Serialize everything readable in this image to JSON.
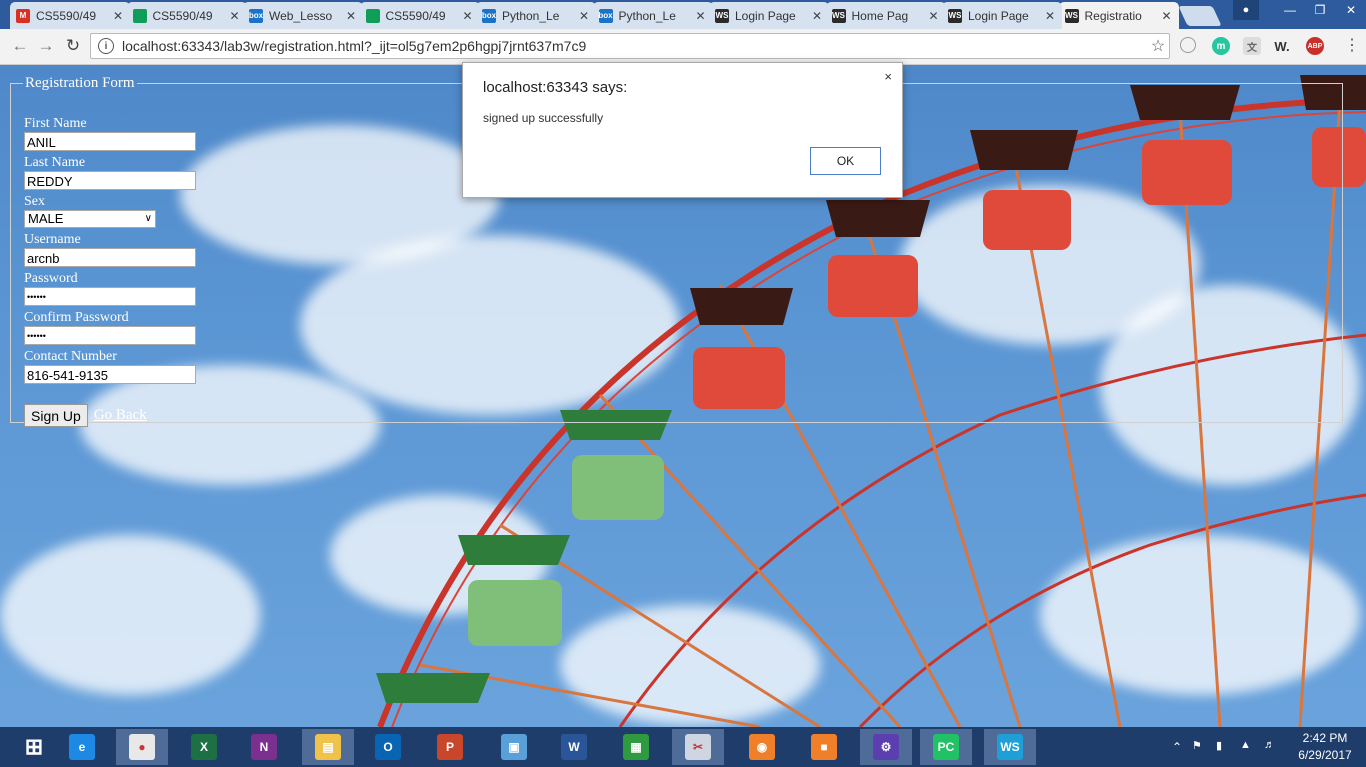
{
  "browser": {
    "tabs": [
      {
        "title": "CS5590/49",
        "icon": "gmail-icon",
        "color": "#d93025",
        "glyph": "M",
        "active": false
      },
      {
        "title": "CS5590/49",
        "icon": "sheets-icon",
        "color": "#0f9d58",
        "glyph": "",
        "active": false
      },
      {
        "title": "Web_Lesso",
        "icon": "box-icon",
        "color": "#1a73c8",
        "glyph": "box",
        "active": false
      },
      {
        "title": "CS5590/49",
        "icon": "sheets-icon",
        "color": "#0f9d58",
        "glyph": "",
        "active": false
      },
      {
        "title": "Python_Le",
        "icon": "box-icon",
        "color": "#1a73c8",
        "glyph": "box",
        "active": false
      },
      {
        "title": "Python_Le",
        "icon": "box-icon",
        "color": "#1a73c8",
        "glyph": "box",
        "active": false
      },
      {
        "title": "Login Page",
        "icon": "webstorm-icon",
        "color": "#2b2b2b",
        "glyph": "WS",
        "active": false
      },
      {
        "title": "Home Pag",
        "icon": "webstorm-icon",
        "color": "#2b2b2b",
        "glyph": "WS",
        "active": false
      },
      {
        "title": "Login Page",
        "icon": "webstorm-icon",
        "color": "#2b2b2b",
        "glyph": "WS",
        "active": false
      },
      {
        "title": "Registratio",
        "icon": "webstorm-icon",
        "color": "#2b2b2b",
        "glyph": "WS",
        "active": true
      }
    ],
    "url": "localhost:63343/lab3w/registration.html?_ijt=ol5g7em2p6hgpj7jrnt637m7c9",
    "extensions": [
      "m",
      "ABP"
    ]
  },
  "form": {
    "legend": "Registration Form",
    "fields": [
      {
        "label": "First Name",
        "value": "ANIL"
      },
      {
        "label": "Last Name",
        "value": "REDDY"
      }
    ],
    "sex": {
      "label": "Sex",
      "value": "MALE"
    },
    "fields2": [
      {
        "label": "Username",
        "value": "arcnb"
      },
      {
        "label": "Password",
        "value": "••••••"
      },
      {
        "label": "Confirm Password",
        "value": "••••••"
      },
      {
        "label": "Contact Number",
        "value": "816-541-9135"
      }
    ],
    "signup_label": "Sign Up",
    "goback_label": "Go Back"
  },
  "dialog": {
    "title": "localhost:63343 says:",
    "message": "signed up successfully",
    "ok_label": "OK",
    "close_glyph": "×"
  },
  "taskbar": {
    "apps": [
      "windows-start",
      "internet-explorer",
      "chrome",
      "excel",
      "onenote",
      "file-explorer",
      "outlook",
      "powerpoint",
      "network-app",
      "word",
      "store",
      "snipping-app",
      "screen-recorder",
      "camera-app",
      "settings",
      "pycharm",
      "webstorm"
    ],
    "time": "2:42 PM",
    "date": "6/29/2017"
  }
}
